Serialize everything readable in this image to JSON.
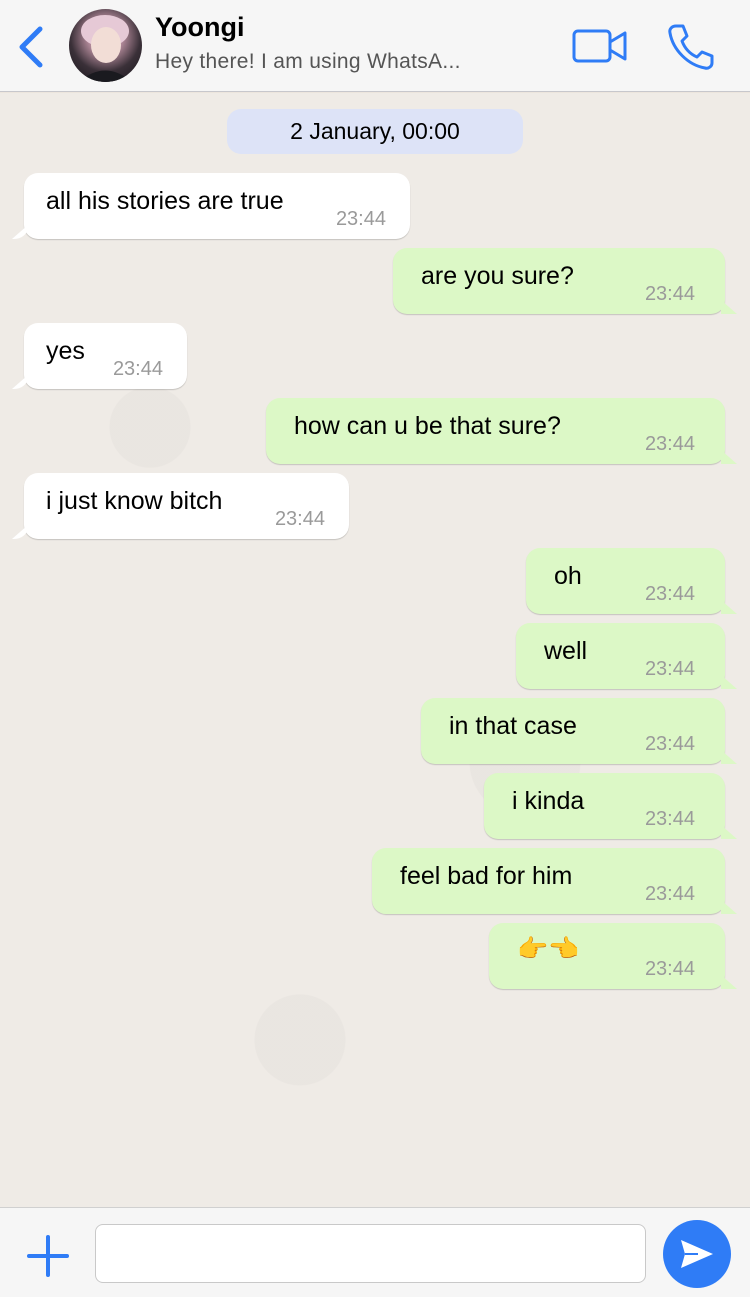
{
  "header": {
    "contact_name": "Yoongi",
    "contact_status": "Hey there! I am using WhatsA...",
    "icons": {
      "back": "chevron-left-icon",
      "video": "video-camera-icon",
      "call": "phone-icon"
    },
    "accent_color": "#2f7cf6"
  },
  "chat": {
    "date_separator": "2 January, 00:00",
    "messages": [
      {
        "direction": "in",
        "text": "all his stories are true",
        "time": "23:44"
      },
      {
        "direction": "out",
        "text": "are you sure?",
        "time": "23:44"
      },
      {
        "direction": "in",
        "text": "yes",
        "time": "23:44"
      },
      {
        "direction": "out",
        "text": "how can u be that sure?",
        "time": "23:44"
      },
      {
        "direction": "in",
        "text": "i just know bitch",
        "time": "23:44"
      },
      {
        "direction": "out",
        "text": "oh",
        "time": "23:44"
      },
      {
        "direction": "out",
        "text": "well",
        "time": "23:44"
      },
      {
        "direction": "out",
        "text": "in that case",
        "time": "23:44"
      },
      {
        "direction": "out",
        "text": "i kinda",
        "time": "23:44"
      },
      {
        "direction": "out",
        "text": "feel bad for him",
        "time": "23:44"
      },
      {
        "direction": "out",
        "text": "👉👈",
        "time": "23:44"
      }
    ],
    "colors": {
      "incoming_bubble": "#ffffff",
      "outgoing_bubble": "#dcf8c6",
      "date_chip": "#dde3f7"
    }
  },
  "input_bar": {
    "message_value": "",
    "icons": {
      "attach": "plus-icon",
      "send": "send-arrow-icon"
    }
  }
}
